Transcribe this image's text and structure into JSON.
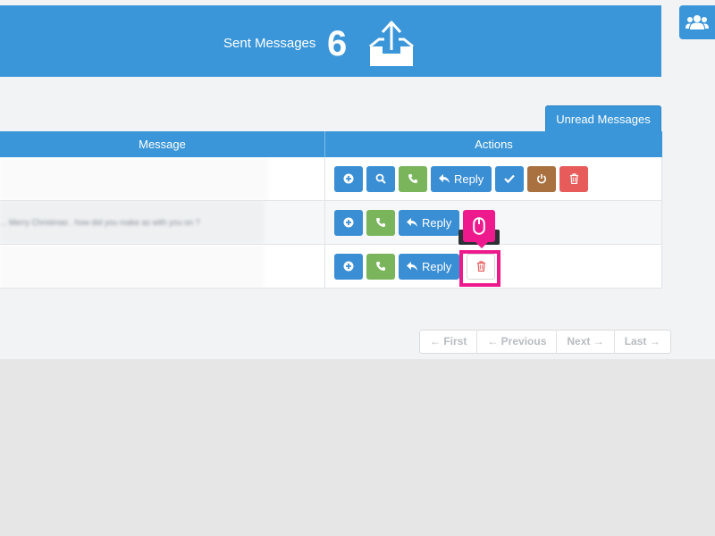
{
  "header": {
    "title": "Sent Messages",
    "count": "6"
  },
  "tabs": {
    "unread_label": "Unread Messages"
  },
  "table": {
    "columns": [
      "Message",
      "Actions"
    ],
    "rows": [
      {
        "message": "",
        "reply_label": "Reply"
      },
      {
        "message": "... Merry Christmas . how did you make as with you on ?",
        "reply_label": "Reply"
      },
      {
        "message": "",
        "reply_label": "Reply"
      }
    ]
  },
  "pagination": {
    "first": "← First",
    "previous": "← Previous",
    "next": "Next →",
    "last": "Last →"
  },
  "colors": {
    "primary": "#3a96d8",
    "success": "#7ab55c",
    "warning": "#a9713f",
    "danger": "#e85b5b",
    "highlight": "#ee1a8d"
  },
  "icons": [
    "outbox-upload-icon",
    "users-icon",
    "plus-circle-icon",
    "search-icon",
    "phone-icon",
    "reply-icon",
    "check-icon",
    "power-icon",
    "trash-icon",
    "mouse-icon"
  ]
}
